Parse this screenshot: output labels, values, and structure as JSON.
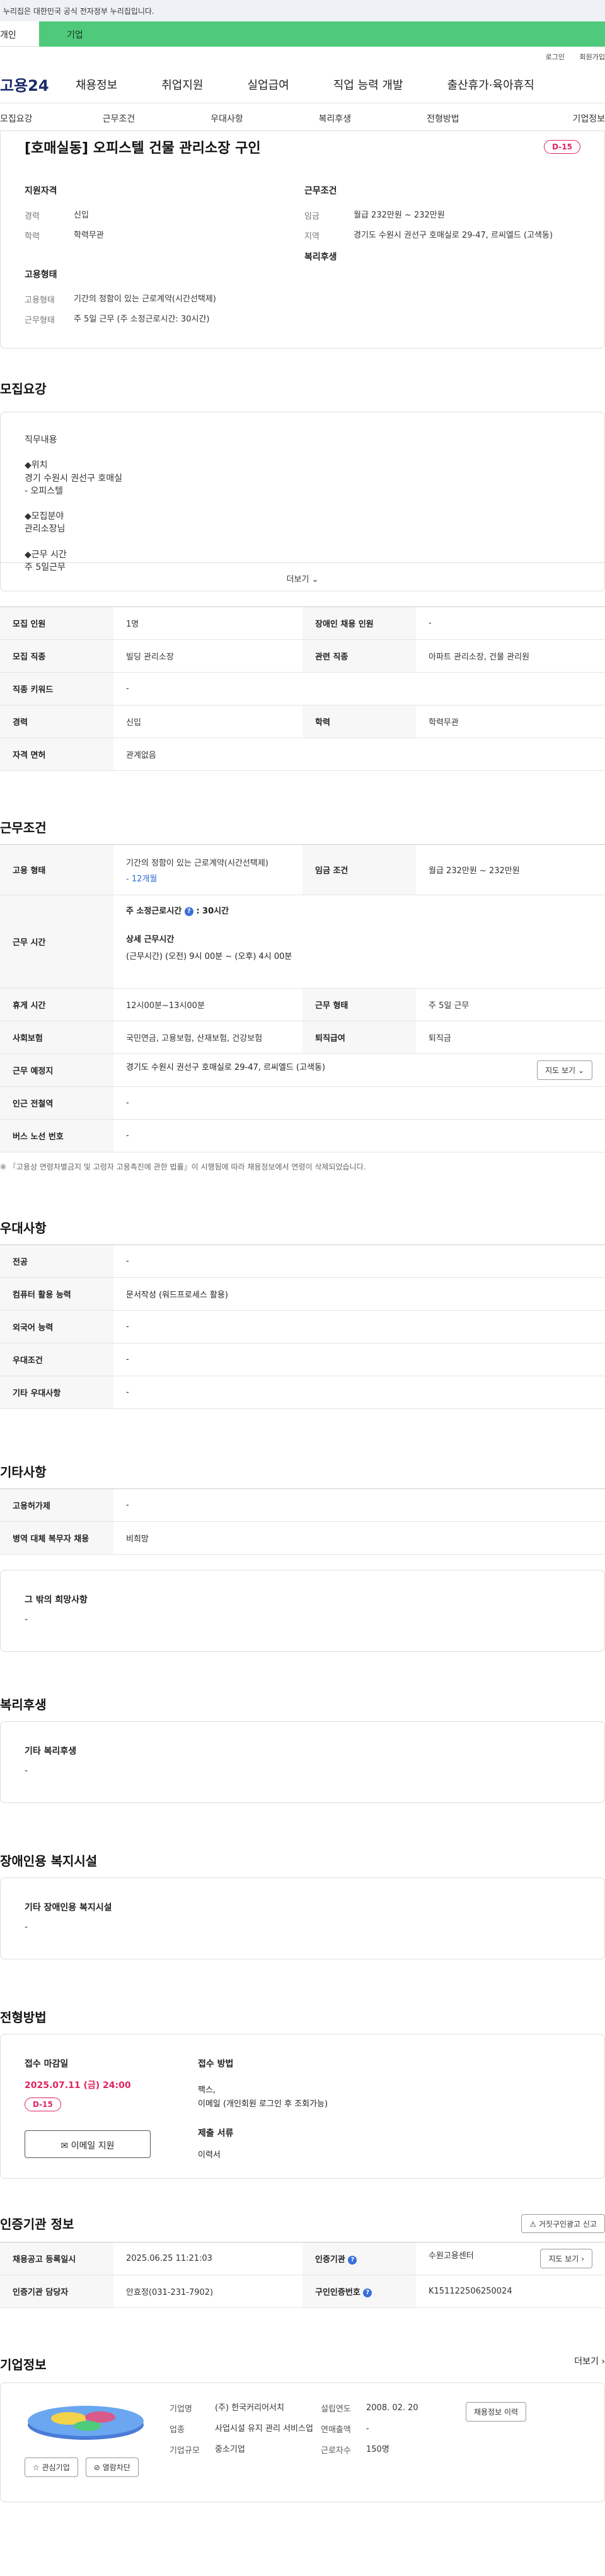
{
  "gov_banner": "이 누리집은 대한민국 공식 전자정부 누리집입니다.",
  "top_tabs": {
    "individual": "개인",
    "business": "기업"
  },
  "util": {
    "login": "로그인",
    "join": "회원가입"
  },
  "logo": "고용24",
  "gnb": [
    "채용정보",
    "취업지원",
    "실업급여",
    "직업 능력 개발",
    "출산휴가·육아휴직"
  ],
  "lnb": [
    "모집요강",
    "근무조건",
    "우대사항",
    "복리후생",
    "전형방법",
    "기업정보"
  ],
  "job": {
    "title": "[호매실동] 오피스텔 건물 관리소장 구인",
    "dday": "D-15",
    "qual_h": "지원자격",
    "qual": [
      {
        "k": "경력",
        "v": "신입"
      },
      {
        "k": "학력",
        "v": "학력무관"
      }
    ],
    "emp_h": "고용형태",
    "emp": [
      {
        "k": "고용형태",
        "v": "기간의 정함이 있는 근로계약(시간선택제)"
      },
      {
        "k": "근무형태",
        "v": "주 5일 근무 (주 소정근로시간: 30시간)"
      }
    ],
    "cond_h": "근무조건",
    "cond": [
      {
        "k": "임금",
        "v": "월급 232만원 ~ 232만원"
      },
      {
        "k": "지역",
        "v": "경기도 수원시 권선구 호매실로 29-47, 르씨엘드 (고색동)"
      }
    ],
    "welfare_h": "복리후생"
  },
  "recruit": {
    "title": "모집요강",
    "desc_lines": [
      "직무내용",
      "",
      "◆위치",
      "경기 수원시 권선구 호매실",
      "- 오피스텔",
      "",
      "◆모집분야",
      "관리소장님",
      "",
      "◆근무 시간",
      "주 5일근무"
    ],
    "more": "더보기",
    "rows": [
      {
        "k1": "모집 인원",
        "v1": "1명",
        "k2": "장애인 채용 인원",
        "v2": "-"
      },
      {
        "k1": "모집 직종",
        "v1": "빌딩 관리소장",
        "k2": "관련 직종",
        "v2": "아파트 관리소장, 건물 관리원"
      },
      {
        "k1": "직종 키워드",
        "v1": "-",
        "k2": "",
        "v2": ""
      },
      {
        "k1": "경력",
        "v1": "신입",
        "k2": "학력",
        "v2": "학력무관"
      },
      {
        "k1": "자격 면허",
        "v1": "관계없음",
        "k2": "",
        "v2": ""
      }
    ]
  },
  "work": {
    "title": "근무조건",
    "emp_k": "고용 형태",
    "emp_v": "기간의 정함이 있는 근로계약(시간선택제)",
    "emp_sub": "- 12개월",
    "wage_k": "임금 조건",
    "wage_v": "월급 232만원 ~ 232만원",
    "hours_k": "근무 시간",
    "hours_week": "주 소정근로시간",
    "hours_week_v": ": 30시간",
    "hours_detail_h": "상세 근무시간",
    "hours_detail": "(근무시간) (오전) 9시 00분 ~ (오후) 4시 00분",
    "break_k": "휴게 시간",
    "break_v": "12시00분~13시00분",
    "form_k": "근무 형태",
    "form_v": "주 5일 근무",
    "ins_k": "사회보험",
    "ins_v": "국민연금, 고용보험, 산재보험, 건강보험",
    "retire_k": "퇴직급여",
    "retire_v": "퇴직금",
    "loc_k": "근무 예정지",
    "loc_v": "경기도 수원시 권선구 호매실로 29-47, 르씨엘드 (고색동)",
    "map_btn": "지도 보기",
    "subway_k": "인근 전철역",
    "subway_v": "-",
    "bus_k": "버스 노선 번호",
    "bus_v": "-",
    "note": "※ 『고용상 연령차별금지 및 고령자 고용촉진에 관한 법률』이 시행됨에 따라 채용정보에서 연령이 삭제되었습니다."
  },
  "pref": {
    "title": "우대사항",
    "rows": [
      {
        "k": "전공",
        "v": "-"
      },
      {
        "k": "컴퓨터 활용 능력",
        "v": "문서작성 (워드프로세스 활용)"
      },
      {
        "k": "외국어 능력",
        "v": "-"
      },
      {
        "k": "우대조건",
        "v": "-"
      },
      {
        "k": "기타 우대사항",
        "v": "-"
      }
    ]
  },
  "etc": {
    "title": "기타사항",
    "rows": [
      {
        "k": "고용허가제",
        "v": "-"
      },
      {
        "k": "병역 대체 복무자 채용",
        "v": "비희망"
      }
    ],
    "box_h": "그 밖의 희망사항",
    "box_v": "-"
  },
  "welfare": {
    "title": "복리후생",
    "box_h": "기타 복리후생",
    "box_v": "-"
  },
  "disabled": {
    "title": "장애인용 복지시설",
    "box_h": "기타 장애인용 복지시설",
    "box_v": "-"
  },
  "selection": {
    "title": "전형방법",
    "deadline_h": "접수 마감일",
    "deadline": "2025.07.11 (금) 24:00",
    "dday": "D-15",
    "email_btn": "이메일 지원",
    "method_h": "접수 방법",
    "method_v1": "팩스,",
    "method_v2": "이메일 (개인회원 로그인 후 조회가능)",
    "docs_h": "제출 서류",
    "docs_v": "이력서"
  },
  "cert": {
    "title": "인증기관 정보",
    "report_btn": "거짓구인광고 신고",
    "reg_k": "채용공고 등록일시",
    "reg_v": "2025.06.25 11:21:03",
    "org_k": "인증기관",
    "org_v": "수원고용센터",
    "map_btn": "지도 보기",
    "mgr_k": "인증기관 담당자",
    "mgr_v": "안효정(031-231-7902)",
    "num_k": "구인인증번호",
    "num_v": "K151122506250024"
  },
  "company": {
    "title": "기업정보",
    "more": "더보기",
    "fav_btn": "관심기업",
    "block_btn": "열람차단",
    "rows_left": [
      {
        "k": "기업명",
        "v": "(주) 한국커리어서치"
      },
      {
        "k": "업종",
        "v": "사업시설 유지 관리 서비스업"
      },
      {
        "k": "기업규모",
        "v": "중소기업"
      }
    ],
    "rows_right": [
      {
        "k": "설립연도",
        "v": "2008. 02. 20"
      },
      {
        "k": "연매출액",
        "v": "-"
      },
      {
        "k": "근로자수",
        "v": "150명"
      }
    ],
    "hist_btn": "채용정보 이력"
  }
}
